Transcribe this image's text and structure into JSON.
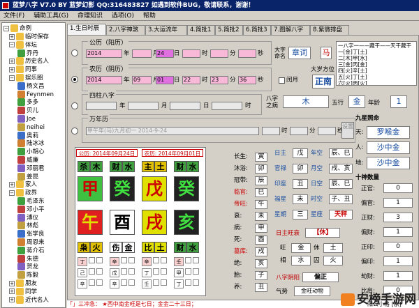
{
  "window": {
    "title": "蓝梦八字 V7.0 BY 蓝梦幻影 QQ:316483827  如遇到软件BUG，敬请联系，谢谢！"
  },
  "menu": [
    "文件(F)",
    "辅助工具(G)",
    "命理知识",
    "选项(O)",
    "帮助"
  ],
  "tree": {
    "root": "命例",
    "nodes": [
      {
        "label": "临时保存",
        "level": 1
      },
      {
        "label": "体坛",
        "level": 1,
        "expanded": true
      },
      {
        "label": "乔丹",
        "level": 2
      },
      {
        "label": "历史名人",
        "level": 1
      },
      {
        "label": "同事",
        "level": 1
      },
      {
        "label": "娱乐圈",
        "level": 1,
        "expanded": true
      },
      {
        "label": "杨文昌",
        "level": 2
      },
      {
        "label": "Feynmen",
        "level": 2
      },
      {
        "label": "多多",
        "level": 2
      },
      {
        "label": "贝儿",
        "level": 2
      },
      {
        "label": "Joe",
        "level": 2
      },
      {
        "label": "neihei",
        "level": 2
      },
      {
        "label": "奥莉",
        "level": 2
      },
      {
        "label": "陆冰冰",
        "level": 2
      },
      {
        "label": "小胡心",
        "level": 2
      },
      {
        "label": "威廉",
        "level": 2
      },
      {
        "label": "邓丽君",
        "level": 2
      },
      {
        "label": "姜昆",
        "level": 2
      },
      {
        "label": "家人",
        "level": 1
      },
      {
        "label": "政界",
        "level": 1,
        "expanded": true
      },
      {
        "label": "毛泽东",
        "level": 2
      },
      {
        "label": "邓小平",
        "level": 2
      },
      {
        "label": "溥仪",
        "level": 2
      },
      {
        "label": "林彪",
        "level": 2
      },
      {
        "label": "张学良",
        "level": 2
      },
      {
        "label": "周恩来",
        "level": 2
      },
      {
        "label": "蒋介石",
        "level": 2
      },
      {
        "label": "朱德",
        "level": 2
      },
      {
        "label": "贺龙",
        "level": 2
      },
      {
        "label": "陈毅",
        "level": 2
      },
      {
        "label": "朋友",
        "level": 1
      },
      {
        "label": "同学",
        "level": 1
      },
      {
        "label": "近代名人",
        "level": 1
      }
    ]
  },
  "tabs": [
    "1.生日时辰",
    "2.八字神煞",
    "3.大运流年",
    "4.简批1",
    "5.简批2",
    "6.简批3",
    "7.图解八字",
    "8.紫微排盘"
  ],
  "gregorian": {
    "group_label": "公历（阳历）",
    "year": "2014",
    "month": "",
    "day": "24",
    "hour": "",
    "minute": "",
    "second": "",
    "unit_year": "年",
    "unit_month": "月",
    "unit_day": "日",
    "unit_hour": "时",
    "unit_minute": "分",
    "unit_second": "秒"
  },
  "lunar": {
    "group_label": "农历（阴历）",
    "year": "2014",
    "month": "09",
    "day": "01",
    "hour": "22",
    "minute": "23",
    "second": "36",
    "leap_label": "闰月"
  },
  "fourpillars": {
    "group_label": "四柱八字"
  },
  "wannian": {
    "group_label": "万年历",
    "value": "甲午年(马)九月初一 2014-9-24",
    "set_button": "设置"
  },
  "side": {
    "dayun_label": "大字命名",
    "dayun_value": "章词",
    "zodiac_value": "马",
    "direction_label": "大岁方位",
    "direction_value": "正南",
    "bazi_label": "八字之病",
    "bazi_value": "木",
    "wuxing_label": "五行",
    "wuxing_value": "金",
    "nianling_label": "年龄",
    "nianling_value": "1"
  },
  "right_list": {
    "header": "一八字一——藏干——天干藏干",
    "rows": [
      "一[金]丁[土]",
      "二[木]甲[水]",
      "三[金]丙[金]",
      "四[火]辛[土]",
      "五[火]丁[土]",
      "六[火]丙[火]"
    ]
  },
  "jiuxing": {
    "header": "九星照命",
    "rows": [
      {
        "label": "天:",
        "value": "罗喉金"
      },
      {
        "label": "人:",
        "value": "沙中金"
      },
      {
        "label": "地:",
        "value": "沙中金"
      }
    ]
  },
  "shishen": {
    "header": "十神数量",
    "rows": [
      {
        "label": "正官:",
        "value": "0"
      },
      {
        "label": "偏官:",
        "value": "1"
      },
      {
        "label": "正财:",
        "value": "3"
      },
      {
        "label": "偏财:",
        "value": "1"
      },
      {
        "label": "正印:",
        "value": "0"
      },
      {
        "label": "偏印:",
        "value": "1"
      },
      {
        "label": "劫财:",
        "value": "1"
      },
      {
        "label": "比肩:",
        "value": "0"
      }
    ]
  },
  "chart": {
    "solar_caption": "公历: 2014年09月24日22时",
    "lunar_caption": "农历: 2014年09月01日22时",
    "shishen_top": [
      "杀",
      "木",
      "财",
      "水",
      "主",
      "土",
      "财",
      "水"
    ],
    "stems": [
      "甲",
      "癸",
      "戊",
      "癸"
    ],
    "branches": [
      "午",
      "酉",
      "戌",
      "亥"
    ],
    "shishen_bottom": [
      "枭",
      "火",
      "伤",
      "金",
      "比",
      "土",
      "财",
      "水"
    ],
    "hidden_labels": [
      "丁",
      "己",
      "辛",
      "戊",
      "辛",
      "丁",
      "壬",
      "甲"
    ]
  },
  "middle": {
    "rows": [
      {
        "label": "长生:",
        "value": "寅"
      },
      {
        "label": "沐浴:",
        "value": "卯"
      },
      {
        "label": "冠带:",
        "value": "辰"
      },
      {
        "label": "临官:",
        "value": "巳"
      },
      {
        "label": "帝旺:",
        "value": "午"
      },
      {
        "label": "衰:",
        "value": "未"
      },
      {
        "label": "病:",
        "value": "申"
      },
      {
        "label": "死:",
        "value": "酉"
      },
      {
        "label": "墓库:",
        "value": "戌"
      },
      {
        "label": "绝:",
        "value": "亥"
      },
      {
        "label": "胎:",
        "value": "子"
      },
      {
        "label": "养:",
        "value": "丑"
      }
    ],
    "right_rows": [
      {
        "a": "日主",
        "av": "戊",
        "b": "年空",
        "bv": "辰、巳"
      },
      {
        "a": "官禄",
        "av": "卯",
        "b": "月空",
        "bv": "戌、亥"
      },
      {
        "a": "印座",
        "av": "丑",
        "b": "日空",
        "bv": "辰、巳"
      },
      {
        "a": "福星",
        "av": "未",
        "b": "时空",
        "bv": "子、丑"
      },
      {
        "a": "星期",
        "av": "三",
        "b": "星座",
        "bv": "天秤"
      }
    ],
    "wang_label": "日主旺衰",
    "wang_value": "【休】",
    "wuxing_rows": [
      {
        "a": "旺",
        "av": "金",
        "b": "休",
        "bv": "土"
      },
      {
        "a": "相",
        "av": "水",
        "b": "囚",
        "bv": "火"
      }
    ],
    "mingju_label": "八字阴阳",
    "mingju_value": "偏正",
    "qi_label": "气势",
    "qi_value": "金旺动物"
  },
  "bottom_bar": "「」三冲急：  ★西中南金旺是七日；金金二十三日；",
  "bottom_right": "阳公小格 [宗]",
  "watermark": "安榜手游网"
}
